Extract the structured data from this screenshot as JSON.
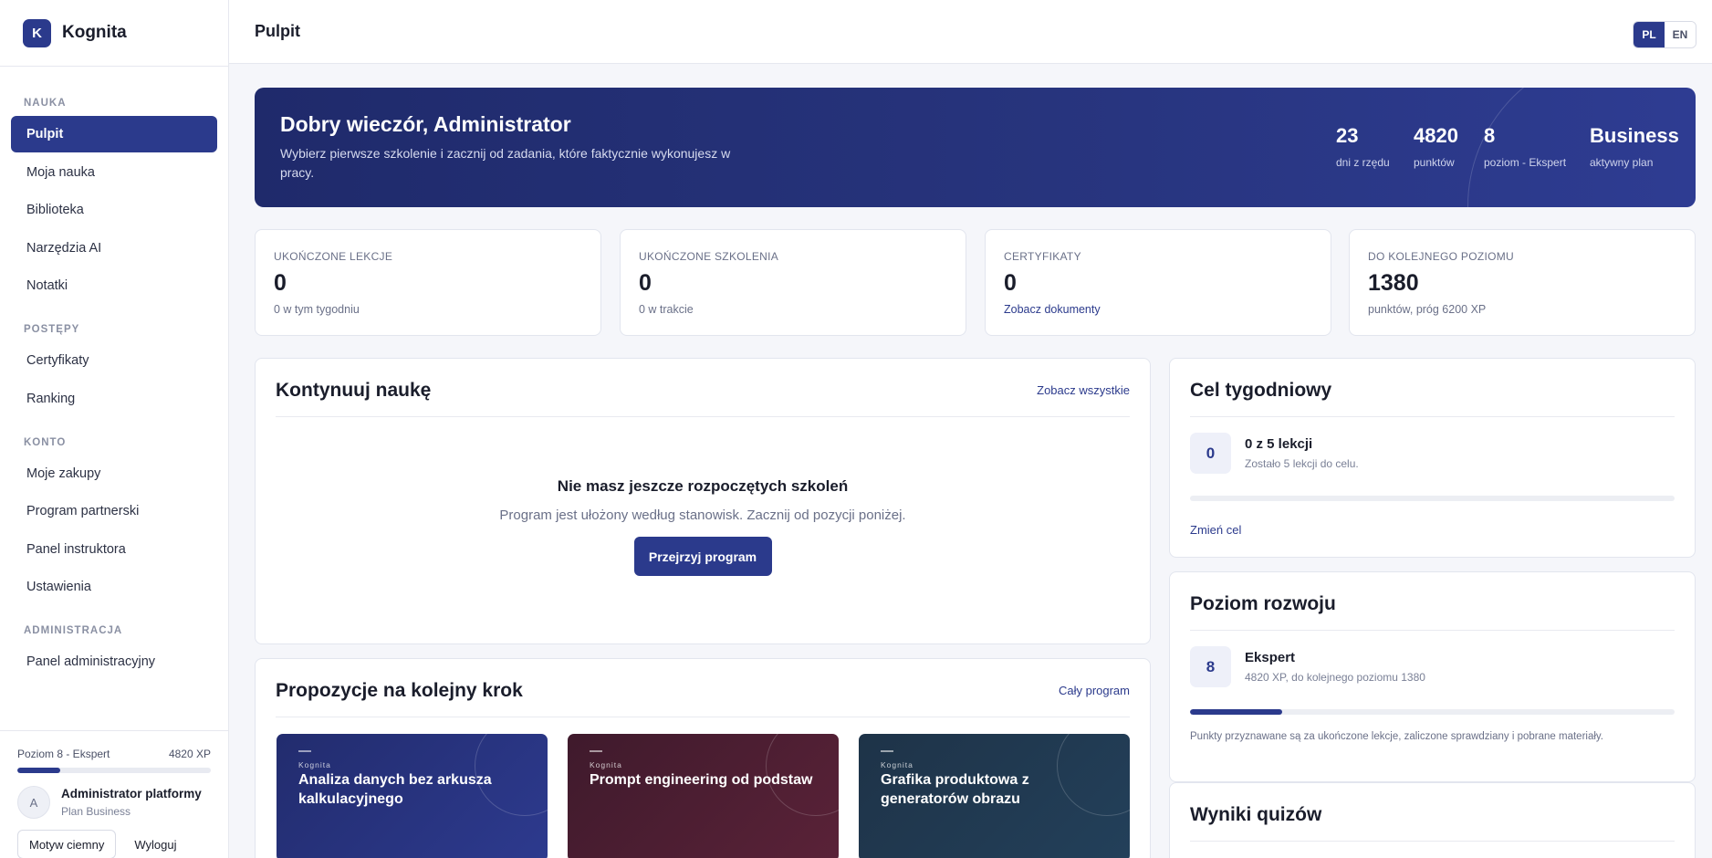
{
  "app": {
    "logo_letter": "K",
    "name": "Kognita"
  },
  "sidebar": {
    "sections": [
      {
        "title": "NAUKA",
        "items": [
          "Pulpit",
          "Moja nauka",
          "Biblioteka",
          "Narzędzia AI",
          "Notatki"
        ]
      },
      {
        "title": "POSTĘPY",
        "items": [
          "Certyfikaty",
          "Ranking"
        ]
      },
      {
        "title": "KONTO",
        "items": [
          "Moje zakupy",
          "Program partnerski",
          "Panel instruktora",
          "Ustawienia"
        ]
      },
      {
        "title": "ADMINISTRACJA",
        "items": [
          "Panel administracyjny"
        ]
      }
    ],
    "active_item": "Pulpit",
    "footer": {
      "level_label": "Poziom 8 - Ekspert",
      "xp": "4820 XP",
      "level_progress": 0.22,
      "avatar_letter": "A",
      "user_name": "Administrator platformy",
      "user_plan": "Plan Business",
      "dark_mode_label": "Motyw ciemny",
      "logout_label": "Wyloguj"
    }
  },
  "topbar": {
    "title": "Pulpit",
    "lang": [
      "PL",
      "EN"
    ],
    "active_lang": "PL"
  },
  "hero": {
    "title": "Dobry wieczór, Administrator",
    "subtitle": "Wybierz pierwsze szkolenie i zacznij od zadania, które faktycznie wykonujesz w pracy.",
    "stats": [
      {
        "value": "23",
        "label": "dni z rzędu"
      },
      {
        "value": "4820",
        "label": "punktów"
      },
      {
        "value": "8",
        "label": "poziom - Ekspert"
      },
      {
        "value": "Business",
        "label": "aktywny plan"
      }
    ]
  },
  "metrics": [
    {
      "label": "UKOŃCZONE LEKCJE",
      "value": "0",
      "sub": "0 w tym tygodniu",
      "is_link": false
    },
    {
      "label": "UKOŃCZONE SZKOLENIA",
      "value": "0",
      "sub": "0 w trakcie",
      "is_link": false
    },
    {
      "label": "CERTYFIKATY",
      "value": "0",
      "sub": "Zobacz dokumenty",
      "is_link": true
    },
    {
      "label": "DO KOLEJNEGO POZIOMU",
      "value": "1380",
      "sub": "punktów, próg 6200 XP",
      "is_link": false
    }
  ],
  "continue": {
    "title": "Kontynuuj naukę",
    "link": "Zobacz wszystkie",
    "empty_title": "Nie masz jeszcze rozpoczętych szkoleń",
    "empty_text": "Program jest ułożony według stanowisk. Zacznij od pozycji poniżej.",
    "button": "Przejrzyj program"
  },
  "suggestions": {
    "title": "Propozycje na kolejny krok",
    "link": "Cały program",
    "courses": [
      {
        "brand": "Kognita",
        "title": "Analiza danych bez arkusza kalkulacyjnego",
        "color_from": "#222c6e",
        "color_to": "#2d3a8e"
      },
      {
        "brand": "Kognita",
        "title": "Prompt engineering od podstaw",
        "color_from": "#3f1a2c",
        "color_to": "#5a2238"
      },
      {
        "brand": "Kognita",
        "title": "Grafika produktowa z generatorów obrazu",
        "color_from": "#1e3348",
        "color_to": "#23405a"
      }
    ]
  },
  "weekly_goal": {
    "title": "Cel tygodniowy",
    "count": "0",
    "goal_title": "0 z 5 lekcji",
    "goal_sub": "Zostało 5 lekcji do celu.",
    "progress": 0,
    "link": "Zmień cel"
  },
  "development": {
    "title": "Poziom rozwoju",
    "level": "8",
    "level_name": "Ekspert",
    "level_sub": "4820 XP, do kolejnego poziomu 1380",
    "progress": 0.19,
    "note": "Punkty przyznawane są za ukończone lekcje, zaliczone sprawdziany i pobrane materiały."
  },
  "quiz": {
    "title": "Wyniki quizów"
  },
  "colors": {
    "accent": "#2b3a8c",
    "background": "#f5f6fa"
  }
}
